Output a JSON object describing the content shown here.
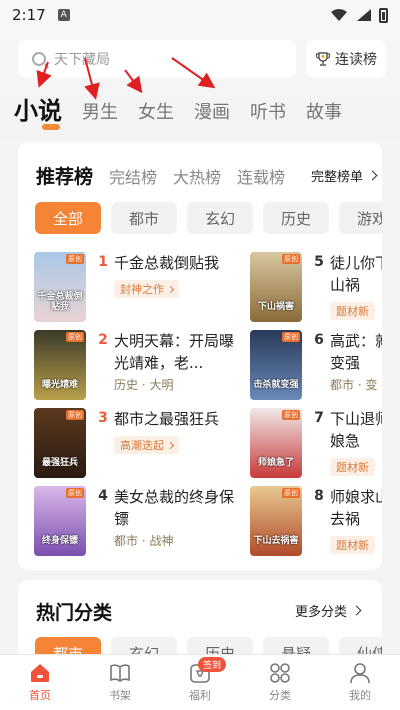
{
  "status_bar": {
    "time": "2:17",
    "notification_letter": "A"
  },
  "search": {
    "placeholder": "天下藏局",
    "read_rank_label": "连读榜"
  },
  "channels": [
    {
      "label": "小说",
      "active": true
    },
    {
      "label": "男生",
      "active": false
    },
    {
      "label": "女生",
      "active": false
    },
    {
      "label": "漫画",
      "active": false
    },
    {
      "label": "听书",
      "active": false
    },
    {
      "label": "故事",
      "active": false
    }
  ],
  "rank_section": {
    "tabs": [
      "推荐榜",
      "完结榜",
      "大热榜",
      "连载榜"
    ],
    "full_list_label": "完整榜单",
    "genres": [
      "全部",
      "都市",
      "玄幻",
      "历史",
      "游戏"
    ],
    "books": [
      {
        "rank": "1",
        "title": "千金总裁倒贴我",
        "tag": "封神之作",
        "meta": "",
        "cover_text": "千金总裁倒贴我",
        "badge": "原创",
        "cover_colors": [
          "#a9c8e8",
          "#e9d3d3"
        ]
      },
      {
        "rank": "2",
        "title": "大明天幕：开局曝光靖难，老...",
        "tag": "",
        "meta": "历史 · 大明",
        "cover_text": "曝光靖难",
        "badge": "原创",
        "cover_colors": [
          "#3a3a2a",
          "#b9a04a"
        ]
      },
      {
        "rank": "3",
        "title": "都市之最强狂兵",
        "tag": "高潮迭起",
        "meta": "",
        "cover_text": "最强狂兵",
        "badge": "原创",
        "cover_colors": [
          "#5b3a20",
          "#2a1a10"
        ]
      },
      {
        "rank": "4",
        "title": "美女总裁的终身保镖",
        "tag": "",
        "meta": "都市 · 战神",
        "cover_text": "终身保镖",
        "badge": "原创",
        "cover_colors": [
          "#d9b8e8",
          "#7a4fb0"
        ]
      },
      {
        "rank": "5",
        "title": "徒儿你下山祸",
        "tag": "题材新",
        "meta": "",
        "cover_text": "下山祸害",
        "badge": "原创",
        "cover_colors": [
          "#d8c8a0",
          "#8a6a3a"
        ]
      },
      {
        "rank": "6",
        "title": "高武：就变强",
        "tag": "",
        "meta": "都市 · 变",
        "cover_text": "击杀就变强",
        "badge": "原创",
        "cover_colors": [
          "#2a3a5a",
          "#6a8ab8"
        ]
      },
      {
        "rank": "7",
        "title": "下山退师娘急",
        "tag": "题材新",
        "meta": "",
        "cover_text": "师娘急了",
        "badge": "原创",
        "cover_colors": [
          "#f0e8e8",
          "#c83a3a"
        ]
      },
      {
        "rank": "8",
        "title": "师娘求山去祸",
        "tag": "题材新",
        "meta": "",
        "cover_text": "下山去祸害",
        "badge": "原创",
        "cover_colors": [
          "#e8c890",
          "#b04a2a"
        ]
      }
    ]
  },
  "hot_section": {
    "title": "热门分类",
    "more_label": "更多分类",
    "categories": [
      "都市",
      "玄幻",
      "历史",
      "悬疑",
      "仙侠"
    ]
  },
  "bottom_nav": [
    {
      "label": "首页",
      "active": true,
      "icon": "home-icon"
    },
    {
      "label": "书架",
      "active": false,
      "icon": "bookshelf-icon"
    },
    {
      "label": "福利",
      "active": false,
      "icon": "gift-icon",
      "badge": "签到"
    },
    {
      "label": "分类",
      "active": false,
      "icon": "category-icon"
    },
    {
      "label": "我的",
      "active": false,
      "icon": "profile-icon"
    }
  ],
  "colors": {
    "accent": "#f58437",
    "rank_highlight": "#e85d3a",
    "nav_active": "#f0533a",
    "arrow_red": "#e02020"
  }
}
